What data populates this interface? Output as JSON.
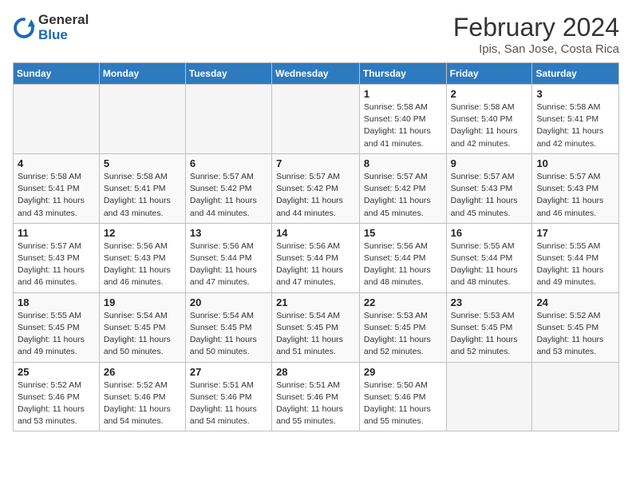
{
  "header": {
    "logo_line1": "General",
    "logo_line2": "Blue",
    "month_year": "February 2024",
    "location": "Ipis, San Jose, Costa Rica"
  },
  "days_of_week": [
    "Sunday",
    "Monday",
    "Tuesday",
    "Wednesday",
    "Thursday",
    "Friday",
    "Saturday"
  ],
  "weeks": [
    [
      {
        "day": "",
        "sunrise": "",
        "sunset": "",
        "daylight": "",
        "empty": true
      },
      {
        "day": "",
        "sunrise": "",
        "sunset": "",
        "daylight": "",
        "empty": true
      },
      {
        "day": "",
        "sunrise": "",
        "sunset": "",
        "daylight": "",
        "empty": true
      },
      {
        "day": "",
        "sunrise": "",
        "sunset": "",
        "daylight": "",
        "empty": true
      },
      {
        "day": "1",
        "sunrise": "Sunrise: 5:58 AM",
        "sunset": "Sunset: 5:40 PM",
        "daylight": "Daylight: 11 hours and 41 minutes."
      },
      {
        "day": "2",
        "sunrise": "Sunrise: 5:58 AM",
        "sunset": "Sunset: 5:40 PM",
        "daylight": "Daylight: 11 hours and 42 minutes."
      },
      {
        "day": "3",
        "sunrise": "Sunrise: 5:58 AM",
        "sunset": "Sunset: 5:41 PM",
        "daylight": "Daylight: 11 hours and 42 minutes."
      }
    ],
    [
      {
        "day": "4",
        "sunrise": "Sunrise: 5:58 AM",
        "sunset": "Sunset: 5:41 PM",
        "daylight": "Daylight: 11 hours and 43 minutes."
      },
      {
        "day": "5",
        "sunrise": "Sunrise: 5:58 AM",
        "sunset": "Sunset: 5:41 PM",
        "daylight": "Daylight: 11 hours and 43 minutes."
      },
      {
        "day": "6",
        "sunrise": "Sunrise: 5:57 AM",
        "sunset": "Sunset: 5:42 PM",
        "daylight": "Daylight: 11 hours and 44 minutes."
      },
      {
        "day": "7",
        "sunrise": "Sunrise: 5:57 AM",
        "sunset": "Sunset: 5:42 PM",
        "daylight": "Daylight: 11 hours and 44 minutes."
      },
      {
        "day": "8",
        "sunrise": "Sunrise: 5:57 AM",
        "sunset": "Sunset: 5:42 PM",
        "daylight": "Daylight: 11 hours and 45 minutes."
      },
      {
        "day": "9",
        "sunrise": "Sunrise: 5:57 AM",
        "sunset": "Sunset: 5:43 PM",
        "daylight": "Daylight: 11 hours and 45 minutes."
      },
      {
        "day": "10",
        "sunrise": "Sunrise: 5:57 AM",
        "sunset": "Sunset: 5:43 PM",
        "daylight": "Daylight: 11 hours and 46 minutes."
      }
    ],
    [
      {
        "day": "11",
        "sunrise": "Sunrise: 5:57 AM",
        "sunset": "Sunset: 5:43 PM",
        "daylight": "Daylight: 11 hours and 46 minutes."
      },
      {
        "day": "12",
        "sunrise": "Sunrise: 5:56 AM",
        "sunset": "Sunset: 5:43 PM",
        "daylight": "Daylight: 11 hours and 46 minutes."
      },
      {
        "day": "13",
        "sunrise": "Sunrise: 5:56 AM",
        "sunset": "Sunset: 5:44 PM",
        "daylight": "Daylight: 11 hours and 47 minutes."
      },
      {
        "day": "14",
        "sunrise": "Sunrise: 5:56 AM",
        "sunset": "Sunset: 5:44 PM",
        "daylight": "Daylight: 11 hours and 47 minutes."
      },
      {
        "day": "15",
        "sunrise": "Sunrise: 5:56 AM",
        "sunset": "Sunset: 5:44 PM",
        "daylight": "Daylight: 11 hours and 48 minutes."
      },
      {
        "day": "16",
        "sunrise": "Sunrise: 5:55 AM",
        "sunset": "Sunset: 5:44 PM",
        "daylight": "Daylight: 11 hours and 48 minutes."
      },
      {
        "day": "17",
        "sunrise": "Sunrise: 5:55 AM",
        "sunset": "Sunset: 5:44 PM",
        "daylight": "Daylight: 11 hours and 49 minutes."
      }
    ],
    [
      {
        "day": "18",
        "sunrise": "Sunrise: 5:55 AM",
        "sunset": "Sunset: 5:45 PM",
        "daylight": "Daylight: 11 hours and 49 minutes."
      },
      {
        "day": "19",
        "sunrise": "Sunrise: 5:54 AM",
        "sunset": "Sunset: 5:45 PM",
        "daylight": "Daylight: 11 hours and 50 minutes."
      },
      {
        "day": "20",
        "sunrise": "Sunrise: 5:54 AM",
        "sunset": "Sunset: 5:45 PM",
        "daylight": "Daylight: 11 hours and 50 minutes."
      },
      {
        "day": "21",
        "sunrise": "Sunrise: 5:54 AM",
        "sunset": "Sunset: 5:45 PM",
        "daylight": "Daylight: 11 hours and 51 minutes."
      },
      {
        "day": "22",
        "sunrise": "Sunrise: 5:53 AM",
        "sunset": "Sunset: 5:45 PM",
        "daylight": "Daylight: 11 hours and 52 minutes."
      },
      {
        "day": "23",
        "sunrise": "Sunrise: 5:53 AM",
        "sunset": "Sunset: 5:45 PM",
        "daylight": "Daylight: 11 hours and 52 minutes."
      },
      {
        "day": "24",
        "sunrise": "Sunrise: 5:52 AM",
        "sunset": "Sunset: 5:45 PM",
        "daylight": "Daylight: 11 hours and 53 minutes."
      }
    ],
    [
      {
        "day": "25",
        "sunrise": "Sunrise: 5:52 AM",
        "sunset": "Sunset: 5:46 PM",
        "daylight": "Daylight: 11 hours and 53 minutes."
      },
      {
        "day": "26",
        "sunrise": "Sunrise: 5:52 AM",
        "sunset": "Sunset: 5:46 PM",
        "daylight": "Daylight: 11 hours and 54 minutes."
      },
      {
        "day": "27",
        "sunrise": "Sunrise: 5:51 AM",
        "sunset": "Sunset: 5:46 PM",
        "daylight": "Daylight: 11 hours and 54 minutes."
      },
      {
        "day": "28",
        "sunrise": "Sunrise: 5:51 AM",
        "sunset": "Sunset: 5:46 PM",
        "daylight": "Daylight: 11 hours and 55 minutes."
      },
      {
        "day": "29",
        "sunrise": "Sunrise: 5:50 AM",
        "sunset": "Sunset: 5:46 PM",
        "daylight": "Daylight: 11 hours and 55 minutes."
      },
      {
        "day": "",
        "sunrise": "",
        "sunset": "",
        "daylight": "",
        "empty": true
      },
      {
        "day": "",
        "sunrise": "",
        "sunset": "",
        "daylight": "",
        "empty": true
      }
    ]
  ]
}
